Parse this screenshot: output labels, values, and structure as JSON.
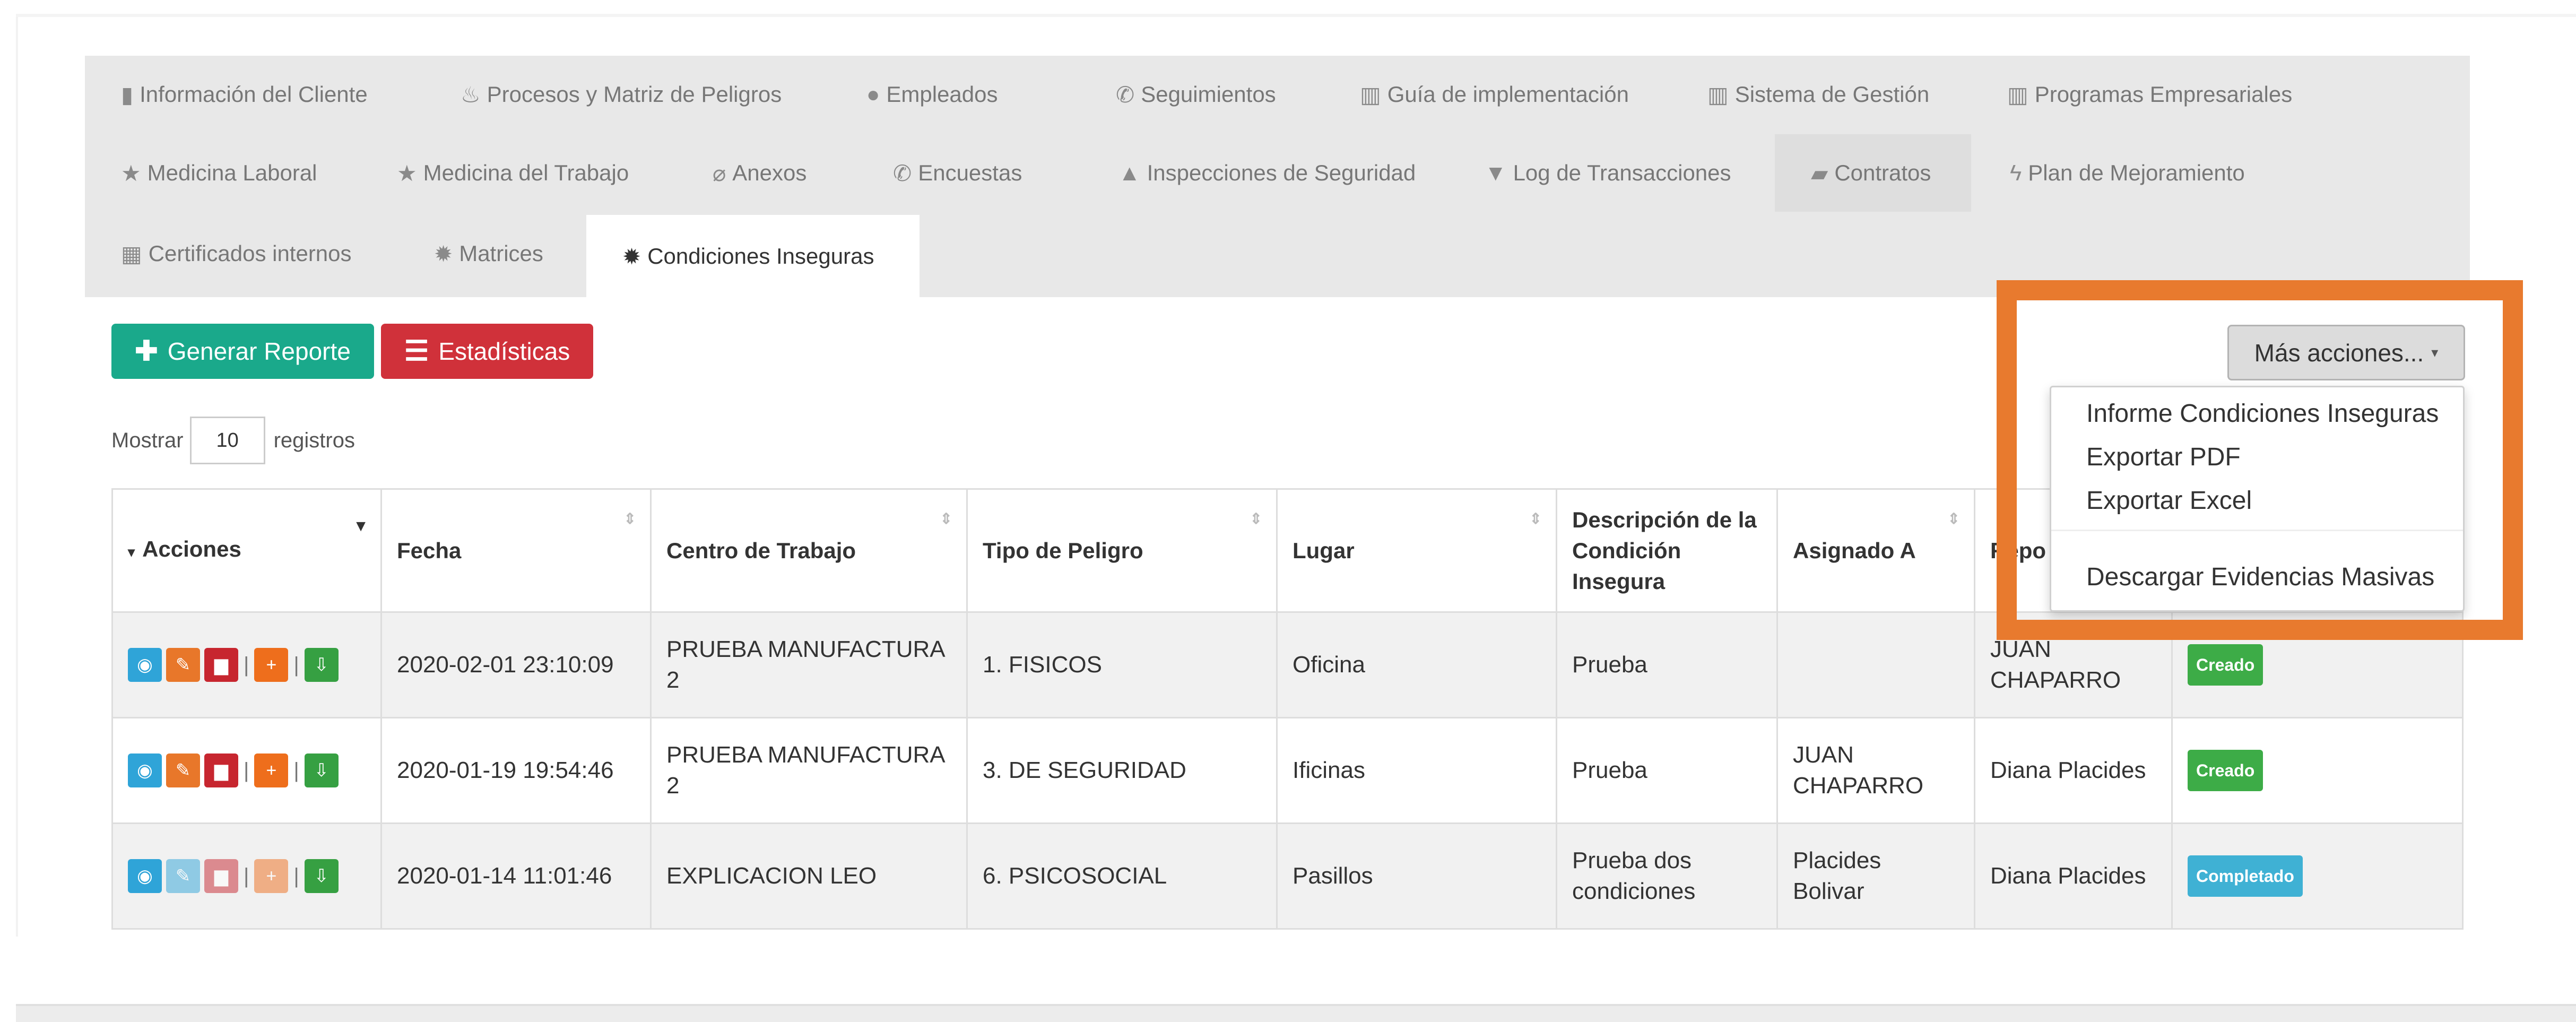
{
  "tabs": [
    {
      "label": "Información del Cliente",
      "icon": "file-icon"
    },
    {
      "label": "Procesos y Matriz de Peligros",
      "icon": "fire-icon"
    },
    {
      "label": "Empleados",
      "icon": "user-icon"
    },
    {
      "label": "Seguimientos",
      "icon": "phone-icon"
    },
    {
      "label": "Guía de implementación",
      "icon": "bar-chart-icon"
    },
    {
      "label": "Sistema de Gestión",
      "icon": "bar-chart-icon"
    },
    {
      "label": "Programas Empresariales",
      "icon": "bar-chart-icon"
    },
    {
      "label": "Medicina Laboral",
      "icon": "star-icon"
    },
    {
      "label": "Medicina del Trabajo",
      "icon": "star-icon"
    },
    {
      "label": "Anexos",
      "icon": "paperclip-icon"
    },
    {
      "label": "Encuestas",
      "icon": "phone-icon"
    },
    {
      "label": "Inspecciones de Seguridad",
      "icon": "warning-icon"
    },
    {
      "label": "Log de Transacciones",
      "icon": "filter-icon"
    },
    {
      "label": "Contratos",
      "icon": "folder-open-icon"
    },
    {
      "label": "Plan de Mejoramiento",
      "icon": "bolt-icon"
    },
    {
      "label": "Certificados internos",
      "icon": "grid-icon"
    },
    {
      "label": "Matrices",
      "icon": "certificate-icon"
    },
    {
      "label": "Condiciones Inseguras",
      "icon": "certificate-icon"
    }
  ],
  "toolbar": {
    "generate_report": "Generar Reporte",
    "statistics": "Estadísticas",
    "more_actions": "Más acciones..."
  },
  "length": {
    "prefix": "Mostrar",
    "value": "10",
    "suffix": "registros"
  },
  "dropdown": {
    "items": [
      "Informe Condiciones Inseguras",
      "Exportar PDF",
      "Exportar Excel",
      "Descargar Evidencias Masivas"
    ]
  },
  "table": {
    "headers": [
      "Acciones",
      "Fecha",
      "Centro de Trabajo",
      "Tipo de Peligro",
      "Lugar",
      "Descripción de la Condición Insegura",
      "Asignado A",
      "Repo"
    ],
    "rows": [
      {
        "fecha": "2020-02-01 23:10:09",
        "centro": "PRUEBA MANUFACTURA 2",
        "tipo": "1. FISICOS",
        "lugar": "Oficina",
        "descripcion": "Prueba",
        "asignado": "",
        "reporta": "JUAN CHAPARRO",
        "estado": "Creado"
      },
      {
        "fecha": "2020-01-19 19:54:46",
        "centro": "PRUEBA MANUFACTURA 2",
        "tipo": "3. DE SEGURIDAD",
        "lugar": "Ificinas",
        "descripcion": "Prueba",
        "asignado": "JUAN CHAPARRO",
        "reporta": "Diana Placides",
        "estado": "Creado"
      },
      {
        "fecha": "2020-01-14 11:01:46",
        "centro": "EXPLICACION LEO",
        "tipo": "6. PSICOSOCIAL",
        "lugar": "Pasillos",
        "descripcion": "Prueba dos condiciones",
        "asignado": "Placides Bolivar",
        "reporta": "Diana Placides",
        "estado": "Completado"
      }
    ]
  },
  "colors": {
    "green_button": "#1aa98b",
    "red_button": "#d0313a",
    "highlight": "#e87a2e",
    "badge_created": "#3dac47",
    "badge_completed": "#3fb1d4"
  }
}
